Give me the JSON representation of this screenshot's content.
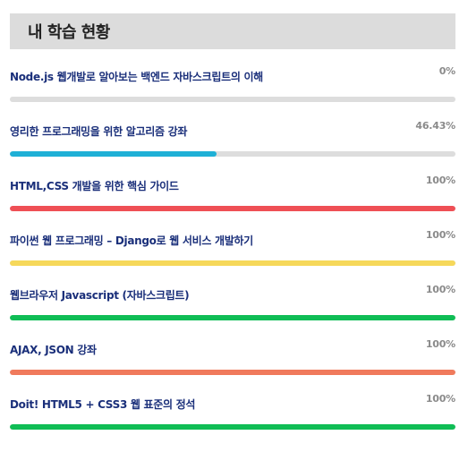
{
  "panel": {
    "title": "내 학습 현황"
  },
  "courses": [
    {
      "title": "Node.js 웹개발로 알아보는 백엔드 자바스크립트의 이해",
      "percent_label": "0%",
      "progress": 0,
      "color": "#36b6d9"
    },
    {
      "title": "영리한 프로그래밍을 위한 알고리즘 강좌",
      "percent_label": "46.43%",
      "progress": 0.4643,
      "color": "#1fb0d6"
    },
    {
      "title": "HTML,CSS 개발을 위한 핵심 가이드",
      "percent_label": "100%",
      "progress": 1,
      "color": "#ef4f55"
    },
    {
      "title": "파이썬 웹 프로그래밍 – Django로 웹 서비스 개발하기",
      "percent_label": "100%",
      "progress": 1,
      "color": "#f6d85a"
    },
    {
      "title": "웹브라우저 Javascript (자바스크립트)",
      "percent_label": "100%",
      "progress": 1,
      "color": "#0fbd55"
    },
    {
      "title": "AJAX, JSON 강좌",
      "percent_label": "100%",
      "progress": 1,
      "color": "#f07a5c"
    },
    {
      "title": "Doit! HTML5 + CSS3 웹 표준의 정석",
      "percent_label": "100%",
      "progress": 1,
      "color": "#0fbd55"
    }
  ]
}
